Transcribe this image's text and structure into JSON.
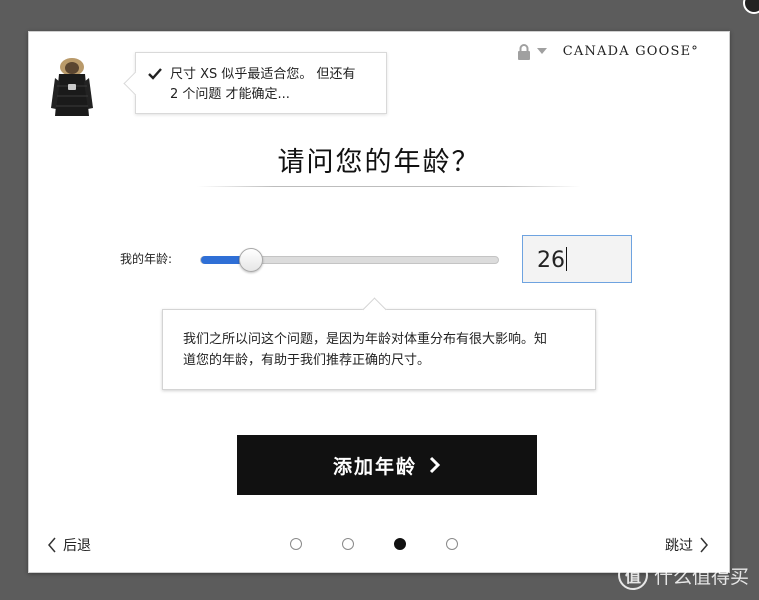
{
  "brand": {
    "name": "CANADA GOOSE",
    "mark": "°"
  },
  "tip": {
    "line1": "尺寸 XS 似乎最适合您。 但还有",
    "line2": "2 个问题 才能确定..."
  },
  "title": "请问您的年龄？",
  "age": {
    "label": "我的年龄:",
    "value": "26",
    "slider_fraction": 0.17
  },
  "explanation": {
    "line1": "我们之所以问这个问题，是因为年龄对体重分布有很大影响。知",
    "line2": "道您的年龄，有助于我们推荐正确的尺寸。"
  },
  "add_button": {
    "label": "添加年龄"
  },
  "nav": {
    "back_label": "后退",
    "skip_label": "跳过"
  },
  "pagination": {
    "total": 4,
    "active_index": 2
  },
  "watermark": {
    "icon_text": "值",
    "text": "什么值得买"
  },
  "colors": {
    "accent": "#2f6fd6",
    "button_bg": "#111111",
    "input_border": "#6ea3e0",
    "backdrop": "#5c5c5c"
  },
  "icons": {
    "lock": "lock-icon",
    "dropdown": "chevron-down-icon",
    "check": "check-icon",
    "forward": "chevron-right-icon",
    "back": "chevron-left-icon"
  }
}
